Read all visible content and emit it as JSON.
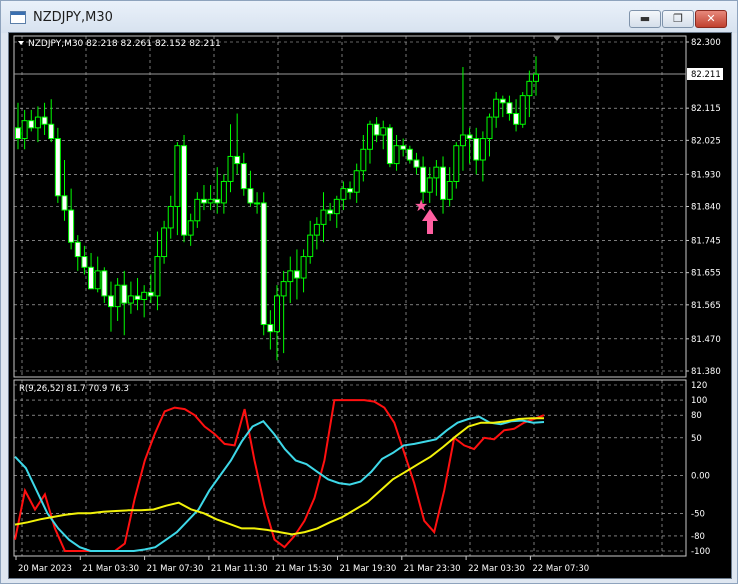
{
  "window": {
    "title": "NZDJPY,M30",
    "buttons": {
      "minimize": "▬",
      "maximize": "❐",
      "close": "✕"
    }
  },
  "chart": {
    "symbol_header": "NZDJPY,M30  82.218 82.261 82.152 82.211",
    "current_price_tag": "82.211",
    "price_axis": [
      "82.300",
      "82.211",
      "82.115",
      "82.025",
      "81.930",
      "81.840",
      "81.745",
      "81.655",
      "81.565",
      "81.470",
      "81.380"
    ],
    "time_axis": [
      "20 Mar 2023",
      "21 Mar 03:30",
      "21 Mar 07:30",
      "21 Mar 11:30",
      "21 Mar 15:30",
      "21 Mar 19:30",
      "21 Mar 23:30",
      "22 Mar 03:30",
      "22 Mar 07:30"
    ],
    "signals": {
      "star": "★",
      "arrow": "up-arrow"
    },
    "colors": {
      "bull": "#ffffff",
      "bear": "#00ff00",
      "wick": "#00ff00",
      "grid": "#c8c8c8"
    }
  },
  "indicator": {
    "label": "R(9,26,52) 81.7 70.9 76.3",
    "axis": [
      "120",
      "100",
      "80",
      "50",
      "0.00",
      "-50",
      "-80",
      "-100"
    ],
    "series": [
      {
        "color": "#ff1010"
      },
      {
        "color": "#3ed8e8"
      },
      {
        "color": "#f2f20a"
      }
    ]
  },
  "chart_data": {
    "type": "candlestick",
    "title": "NZDJPY,M30",
    "ylim": [
      81.38,
      82.3
    ],
    "candles": [
      {
        "o": 82.06,
        "h": 82.13,
        "l": 82.0,
        "c": 82.03
      },
      {
        "o": 82.03,
        "h": 82.11,
        "l": 82.0,
        "c": 82.08
      },
      {
        "o": 82.08,
        "h": 82.11,
        "l": 82.05,
        "c": 82.06
      },
      {
        "o": 82.06,
        "h": 82.12,
        "l": 82.02,
        "c": 82.09
      },
      {
        "o": 82.09,
        "h": 82.13,
        "l": 82.04,
        "c": 82.07
      },
      {
        "o": 82.07,
        "h": 82.14,
        "l": 82.02,
        "c": 82.03
      },
      {
        "o": 82.03,
        "h": 82.06,
        "l": 81.85,
        "c": 81.87
      },
      {
        "o": 81.87,
        "h": 81.97,
        "l": 81.8,
        "c": 81.83
      },
      {
        "o": 81.83,
        "h": 81.89,
        "l": 81.72,
        "c": 81.74
      },
      {
        "o": 81.74,
        "h": 81.76,
        "l": 81.66,
        "c": 81.7
      },
      {
        "o": 81.7,
        "h": 81.73,
        "l": 81.65,
        "c": 81.67
      },
      {
        "o": 81.67,
        "h": 81.71,
        "l": 81.61,
        "c": 81.61
      },
      {
        "o": 81.61,
        "h": 81.7,
        "l": 81.6,
        "c": 81.66
      },
      {
        "o": 81.66,
        "h": 81.67,
        "l": 81.57,
        "c": 81.59
      },
      {
        "o": 81.59,
        "h": 81.63,
        "l": 81.49,
        "c": 81.56
      },
      {
        "o": 81.56,
        "h": 81.64,
        "l": 81.52,
        "c": 81.62
      },
      {
        "o": 81.62,
        "h": 81.66,
        "l": 81.48,
        "c": 81.57
      },
      {
        "o": 81.57,
        "h": 81.63,
        "l": 81.54,
        "c": 81.59
      },
      {
        "o": 81.59,
        "h": 81.64,
        "l": 81.55,
        "c": 81.58
      },
      {
        "o": 81.58,
        "h": 81.62,
        "l": 81.53,
        "c": 81.6
      },
      {
        "o": 81.6,
        "h": 81.65,
        "l": 81.57,
        "c": 81.59
      },
      {
        "o": 81.59,
        "h": 81.77,
        "l": 81.55,
        "c": 81.7
      },
      {
        "o": 81.7,
        "h": 81.8,
        "l": 81.68,
        "c": 81.78
      },
      {
        "o": 81.78,
        "h": 81.87,
        "l": 81.75,
        "c": 81.84
      },
      {
        "o": 81.84,
        "h": 82.02,
        "l": 81.76,
        "c": 82.01
      },
      {
        "o": 82.01,
        "h": 82.04,
        "l": 81.74,
        "c": 81.76
      },
      {
        "o": 81.76,
        "h": 81.82,
        "l": 81.73,
        "c": 81.8
      },
      {
        "o": 81.8,
        "h": 81.88,
        "l": 81.78,
        "c": 81.86
      },
      {
        "o": 81.86,
        "h": 81.9,
        "l": 81.83,
        "c": 81.85
      },
      {
        "o": 81.85,
        "h": 81.9,
        "l": 81.83,
        "c": 81.86
      },
      {
        "o": 81.86,
        "h": 81.95,
        "l": 81.82,
        "c": 81.85
      },
      {
        "o": 81.85,
        "h": 81.93,
        "l": 81.82,
        "c": 81.91
      },
      {
        "o": 81.91,
        "h": 82.07,
        "l": 81.88,
        "c": 81.98
      },
      {
        "o": 81.98,
        "h": 82.1,
        "l": 81.93,
        "c": 81.96
      },
      {
        "o": 81.96,
        "h": 81.99,
        "l": 81.87,
        "c": 81.89
      },
      {
        "o": 81.89,
        "h": 81.94,
        "l": 81.84,
        "c": 81.85
      },
      {
        "o": 81.85,
        "h": 81.88,
        "l": 81.82,
        "c": 81.85
      },
      {
        "o": 81.85,
        "h": 81.88,
        "l": 81.48,
        "c": 81.51
      },
      {
        "o": 81.51,
        "h": 81.55,
        "l": 81.44,
        "c": 81.49
      },
      {
        "o": 81.49,
        "h": 81.62,
        "l": 81.41,
        "c": 81.59
      },
      {
        "o": 81.59,
        "h": 81.66,
        "l": 81.43,
        "c": 81.63
      },
      {
        "o": 81.63,
        "h": 81.7,
        "l": 81.57,
        "c": 81.66
      },
      {
        "o": 81.66,
        "h": 81.72,
        "l": 81.58,
        "c": 81.64
      },
      {
        "o": 81.64,
        "h": 81.72,
        "l": 81.6,
        "c": 81.7
      },
      {
        "o": 81.7,
        "h": 81.8,
        "l": 81.68,
        "c": 81.76
      },
      {
        "o": 81.76,
        "h": 81.81,
        "l": 81.72,
        "c": 81.79
      },
      {
        "o": 81.79,
        "h": 81.88,
        "l": 81.74,
        "c": 81.83
      },
      {
        "o": 81.83,
        "h": 81.85,
        "l": 81.8,
        "c": 81.82
      },
      {
        "o": 81.82,
        "h": 81.87,
        "l": 81.78,
        "c": 81.86
      },
      {
        "o": 81.86,
        "h": 81.91,
        "l": 81.83,
        "c": 81.89
      },
      {
        "o": 81.89,
        "h": 81.91,
        "l": 81.86,
        "c": 81.88
      },
      {
        "o": 81.88,
        "h": 81.96,
        "l": 81.85,
        "c": 81.94
      },
      {
        "o": 81.94,
        "h": 82.04,
        "l": 81.91,
        "c": 82.0
      },
      {
        "o": 82.0,
        "h": 82.08,
        "l": 81.96,
        "c": 82.07
      },
      {
        "o": 82.07,
        "h": 82.09,
        "l": 82.02,
        "c": 82.04
      },
      {
        "o": 82.04,
        "h": 82.08,
        "l": 82.0,
        "c": 82.06
      },
      {
        "o": 82.06,
        "h": 82.07,
        "l": 81.95,
        "c": 81.96
      },
      {
        "o": 81.96,
        "h": 82.04,
        "l": 81.94,
        "c": 82.01
      },
      {
        "o": 82.01,
        "h": 82.03,
        "l": 81.98,
        "c": 82.0
      },
      {
        "o": 82.0,
        "h": 82.01,
        "l": 81.96,
        "c": 81.97
      },
      {
        "o": 81.97,
        "h": 81.99,
        "l": 81.93,
        "c": 81.95
      },
      {
        "o": 81.95,
        "h": 81.98,
        "l": 81.85,
        "c": 81.88
      },
      {
        "o": 81.88,
        "h": 81.95,
        "l": 81.85,
        "c": 81.92
      },
      {
        "o": 81.92,
        "h": 81.97,
        "l": 81.87,
        "c": 81.95
      },
      {
        "o": 81.95,
        "h": 81.98,
        "l": 81.82,
        "c": 81.86
      },
      {
        "o": 81.86,
        "h": 81.95,
        "l": 81.84,
        "c": 81.91
      },
      {
        "o": 81.91,
        "h": 82.02,
        "l": 81.89,
        "c": 82.01
      },
      {
        "o": 82.01,
        "h": 82.23,
        "l": 81.94,
        "c": 82.04
      },
      {
        "o": 82.04,
        "h": 82.06,
        "l": 81.96,
        "c": 82.03
      },
      {
        "o": 82.03,
        "h": 82.06,
        "l": 81.93,
        "c": 81.97
      },
      {
        "o": 81.97,
        "h": 82.05,
        "l": 81.91,
        "c": 82.03
      },
      {
        "o": 82.03,
        "h": 82.1,
        "l": 81.98,
        "c": 82.09
      },
      {
        "o": 82.09,
        "h": 82.16,
        "l": 82.06,
        "c": 82.14
      },
      {
        "o": 82.14,
        "h": 82.15,
        "l": 82.09,
        "c": 82.13
      },
      {
        "o": 82.13,
        "h": 82.15,
        "l": 82.08,
        "c": 82.1
      },
      {
        "o": 82.1,
        "h": 82.14,
        "l": 82.05,
        "c": 82.07
      },
      {
        "o": 82.07,
        "h": 82.16,
        "l": 82.06,
        "c": 82.15
      },
      {
        "o": 82.15,
        "h": 82.22,
        "l": 82.09,
        "c": 82.19
      },
      {
        "o": 82.19,
        "h": 82.26,
        "l": 82.15,
        "c": 82.21
      }
    ],
    "indicator_series": [
      {
        "values": [
          -85,
          -20,
          -45,
          -25,
          -70,
          -100,
          -100,
          -100,
          -100,
          -100,
          -100,
          -90,
          -30,
          20,
          55,
          85,
          90,
          88,
          80,
          65,
          55,
          42,
          40,
          88,
          20,
          -40,
          -85,
          -95,
          -80,
          -60,
          -30,
          20,
          100,
          100,
          100,
          100,
          98,
          90,
          70,
          30,
          -10,
          -60,
          -75,
          -20,
          50,
          40,
          35,
          50,
          48,
          60,
          62,
          70,
          75,
          80
        ]
      },
      {
        "values": [
          25,
          10,
          -20,
          -50,
          -70,
          -85,
          -95,
          -100,
          -100,
          -100,
          -100,
          -100,
          -98,
          -95,
          -85,
          -75,
          -60,
          -45,
          -20,
          0,
          20,
          45,
          65,
          72,
          55,
          35,
          20,
          15,
          5,
          -5,
          -10,
          -12,
          -8,
          5,
          22,
          30,
          40,
          42,
          45,
          48,
          60,
          70,
          75,
          78,
          70,
          68,
          72,
          73,
          70,
          71
        ]
      },
      {
        "values": [
          -65,
          -62,
          -58,
          -55,
          -52,
          -50,
          -50,
          -48,
          -47,
          -46,
          -46,
          -45,
          -40,
          -36,
          -45,
          -50,
          -58,
          -64,
          -70,
          -70,
          -72,
          -75,
          -78,
          -75,
          -70,
          -62,
          -55,
          -45,
          -35,
          -20,
          -5,
          5,
          15,
          25,
          38,
          52,
          65,
          70,
          70,
          72,
          75,
          76,
          76
        ]
      }
    ]
  }
}
